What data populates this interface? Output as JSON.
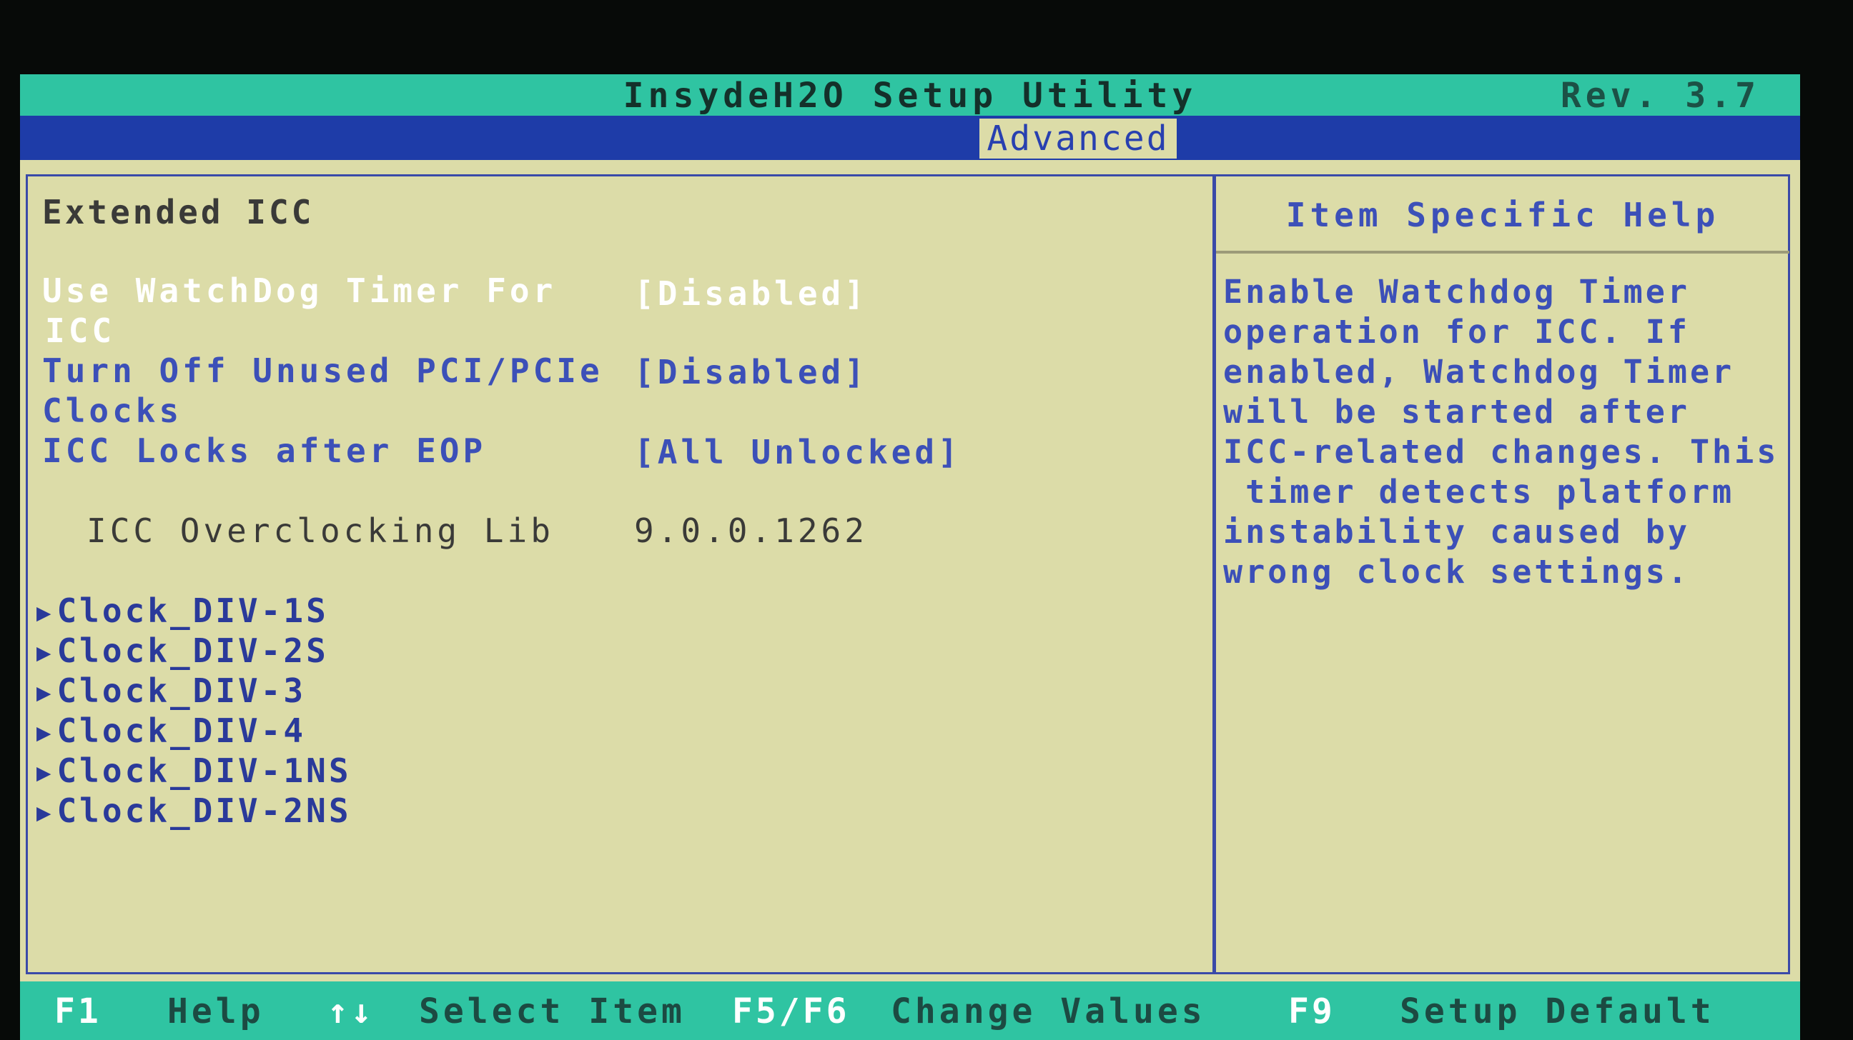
{
  "header": {
    "title": "InsydeH2O Setup Utility",
    "revision": "Rev. 3.7"
  },
  "tabs": {
    "active": "Advanced"
  },
  "main": {
    "section_title": "Extended ICC",
    "settings": [
      {
        "label_line1": "Use WatchDog Timer For",
        "label_line2": "ICC",
        "value": "[Disabled]"
      },
      {
        "label_line1": "Turn Off Unused PCI/PCIe",
        "label_line2": "Clocks",
        "value": "[Disabled]"
      },
      {
        "label_line1": "ICC Locks after EOP",
        "value": "[All Unlocked]"
      },
      {
        "label_line1": "ICC Overclocking Lib",
        "value": "9.0.0.1262"
      }
    ],
    "submenus": [
      "Clock_DIV-1S",
      "Clock_DIV-2S",
      "Clock_DIV-3",
      "Clock_DIV-4",
      "Clock_DIV-1NS",
      "Clock_DIV-2NS"
    ]
  },
  "help": {
    "title": "Item Specific Help",
    "lines": [
      "Enable Watchdog Timer",
      "operation for ICC. If",
      "enabled, Watchdog Timer",
      "will be started after",
      "ICC-related changes. This",
      " timer detects platform",
      "instability caused by",
      "wrong clock settings."
    ]
  },
  "footer": {
    "keys": [
      {
        "key": "F1",
        "desc": "Help"
      },
      {
        "key": "↑↓",
        "desc": "Select Item"
      },
      {
        "key": "F5/F6",
        "desc": "Change Values"
      },
      {
        "key": "F9",
        "desc": "Setup Default"
      }
    ]
  },
  "colors": {
    "background": "#dcdca8",
    "title_bar": "#2fc4a2",
    "tab_bar": "#1e3ca8",
    "text_blue": "#3c50b8",
    "selected_text": "#ffffff"
  }
}
